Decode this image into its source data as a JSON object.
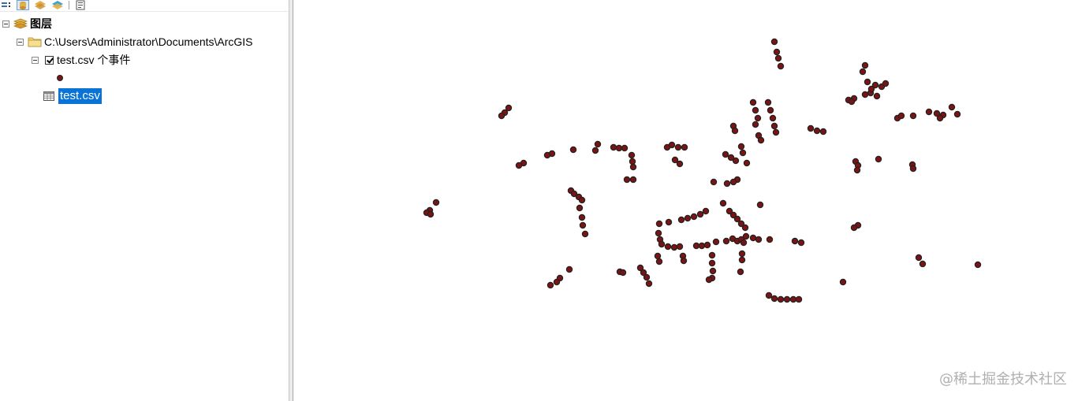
{
  "toc": {
    "root_label": "图层",
    "folder_path": "C:\\Users\\Administrator\\Documents\\ArcGIS",
    "event_layer_label": "test.csv 个事件",
    "table_label": "test.csv",
    "toolbar": {
      "buttons": [
        "list-by-drawing-order-icon",
        "list-by-source-icon",
        "list-by-visibility-icon",
        "list-by-selection-icon",
        "options-icon"
      ]
    }
  },
  "map": {
    "point_fill": "#7a1414",
    "point_stroke": "#222222",
    "clusters": [
      [
        982,
        53
      ],
      [
        985,
        66
      ],
      [
        987,
        74
      ],
      [
        990,
        84
      ],
      [
        1097,
        83
      ],
      [
        1094,
        91
      ],
      [
        1100,
        104
      ],
      [
        1110,
        108
      ],
      [
        1118,
        110
      ],
      [
        1123,
        106
      ],
      [
        1104,
        118
      ],
      [
        1097,
        120
      ],
      [
        1112,
        122
      ],
      [
        1105,
        113
      ],
      [
        1083,
        125
      ],
      [
        1076,
        127
      ],
      [
        1080,
        129
      ],
      [
        645,
        137
      ],
      [
        640,
        143
      ],
      [
        636,
        147
      ],
      [
        955,
        130
      ],
      [
        958,
        140
      ],
      [
        961,
        150
      ],
      [
        958,
        158
      ],
      [
        974,
        130
      ],
      [
        977,
        140
      ],
      [
        980,
        150
      ],
      [
        982,
        160
      ],
      [
        984,
        168
      ],
      [
        962,
        172
      ],
      [
        965,
        178
      ],
      [
        1138,
        150
      ],
      [
        1143,
        147
      ],
      [
        1158,
        147
      ],
      [
        1178,
        142
      ],
      [
        1188,
        144
      ],
      [
        1196,
        146
      ],
      [
        1207,
        136
      ],
      [
        1214,
        145
      ],
      [
        1192,
        150
      ],
      [
        930,
        160
      ],
      [
        932,
        166
      ],
      [
        1028,
        163
      ],
      [
        1036,
        166
      ],
      [
        1044,
        167
      ],
      [
        758,
        183
      ],
      [
        755,
        191
      ],
      [
        778,
        187
      ],
      [
        785,
        188
      ],
      [
        792,
        188
      ],
      [
        846,
        187
      ],
      [
        852,
        184
      ],
      [
        860,
        187
      ],
      [
        868,
        187
      ],
      [
        727,
        190
      ],
      [
        700,
        195
      ],
      [
        694,
        197
      ],
      [
        940,
        186
      ],
      [
        942,
        194
      ],
      [
        920,
        196
      ],
      [
        927,
        200
      ],
      [
        933,
        204
      ],
      [
        947,
        207
      ],
      [
        801,
        197
      ],
      [
        802,
        205
      ],
      [
        803,
        212
      ],
      [
        664,
        207
      ],
      [
        658,
        210
      ],
      [
        856,
        203
      ],
      [
        862,
        208
      ],
      [
        1085,
        205
      ],
      [
        1088,
        210
      ],
      [
        1087,
        216
      ],
      [
        1114,
        202
      ],
      [
        1157,
        209
      ],
      [
        1158,
        214
      ],
      [
        795,
        228
      ],
      [
        803,
        228
      ],
      [
        935,
        228
      ],
      [
        930,
        231
      ],
      [
        905,
        231
      ],
      [
        922,
        233
      ],
      [
        724,
        242
      ],
      [
        728,
        246
      ],
      [
        734,
        250
      ],
      [
        738,
        254
      ],
      [
        735,
        264
      ],
      [
        738,
        276
      ],
      [
        739,
        286
      ],
      [
        742,
        297
      ],
      [
        553,
        257
      ],
      [
        545,
        267
      ],
      [
        541,
        270
      ],
      [
        546,
        272
      ],
      [
        917,
        258
      ],
      [
        964,
        260
      ],
      [
        925,
        268
      ],
      [
        930,
        273
      ],
      [
        935,
        278
      ],
      [
        940,
        284
      ],
      [
        945,
        289
      ],
      [
        895,
        268
      ],
      [
        888,
        272
      ],
      [
        880,
        275
      ],
      [
        872,
        277
      ],
      [
        864,
        279
      ],
      [
        848,
        282
      ],
      [
        836,
        284
      ],
      [
        1088,
        286
      ],
      [
        1083,
        289
      ],
      [
        835,
        296
      ],
      [
        837,
        304
      ],
      [
        839,
        310
      ],
      [
        847,
        313
      ],
      [
        855,
        314
      ],
      [
        862,
        313
      ],
      [
        883,
        312
      ],
      [
        890,
        312
      ],
      [
        897,
        311
      ],
      [
        908,
        307
      ],
      [
        921,
        306
      ],
      [
        929,
        303
      ],
      [
        935,
        306
      ],
      [
        940,
        304
      ],
      [
        946,
        300
      ],
      [
        955,
        302
      ],
      [
        962,
        304
      ],
      [
        976,
        304
      ],
      [
        1008,
        306
      ],
      [
        1016,
        308
      ],
      [
        943,
        308
      ],
      [
        903,
        324
      ],
      [
        903,
        334
      ],
      [
        904,
        344
      ],
      [
        903,
        353
      ],
      [
        899,
        355
      ],
      [
        941,
        322
      ],
      [
        941,
        330
      ],
      [
        939,
        345
      ],
      [
        834,
        325
      ],
      [
        836,
        332
      ],
      [
        866,
        325
      ],
      [
        867,
        331
      ],
      [
        1165,
        327
      ],
      [
        1170,
        335
      ],
      [
        1240,
        336
      ],
      [
        812,
        340
      ],
      [
        816,
        346
      ],
      [
        820,
        352
      ],
      [
        823,
        360
      ],
      [
        786,
        345
      ],
      [
        790,
        346
      ],
      [
        722,
        342
      ],
      [
        710,
        353
      ],
      [
        706,
        358
      ],
      [
        698,
        362
      ],
      [
        1069,
        358
      ],
      [
        975,
        375
      ],
      [
        982,
        379
      ],
      [
        990,
        380
      ],
      [
        998,
        380
      ],
      [
        1006,
        380
      ],
      [
        1013,
        380
      ]
    ]
  },
  "watermark": "@稀土掘金技术社区"
}
